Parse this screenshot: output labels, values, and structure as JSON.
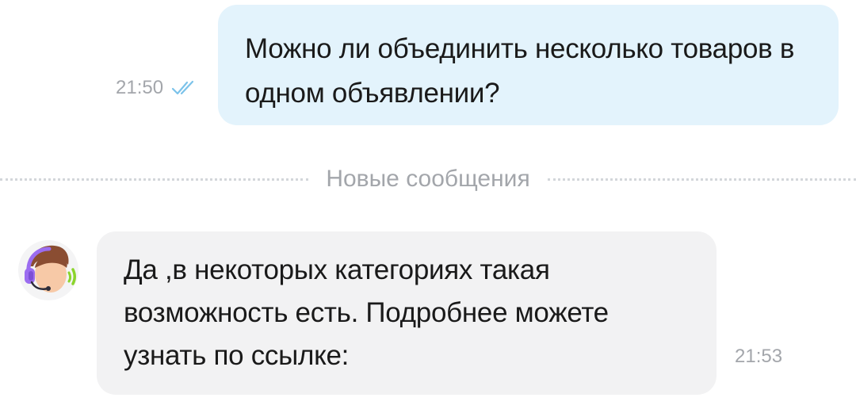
{
  "messages": {
    "outgoing": {
      "text": "Можно ли объединить несколько товаров в одном объявлении?",
      "time": "21:50",
      "status_icon": "double-check-icon",
      "status_color": "#7cc3ea"
    },
    "divider": {
      "label": "Новые сообщения"
    },
    "incoming": {
      "avatar_icon": "support-agent-avatar-icon",
      "text": "Да ,в некоторых категориях такая возможность есть. Подробнее можете узнать по ссылке:",
      "time": "21:53"
    }
  },
  "colors": {
    "outgoing_bubble": "#e3f3fc",
    "incoming_bubble": "#f2f2f3",
    "meta_text": "#a3a6ab",
    "headset_purple": "#9b6cf0",
    "headset_green": "#8bd42c"
  }
}
